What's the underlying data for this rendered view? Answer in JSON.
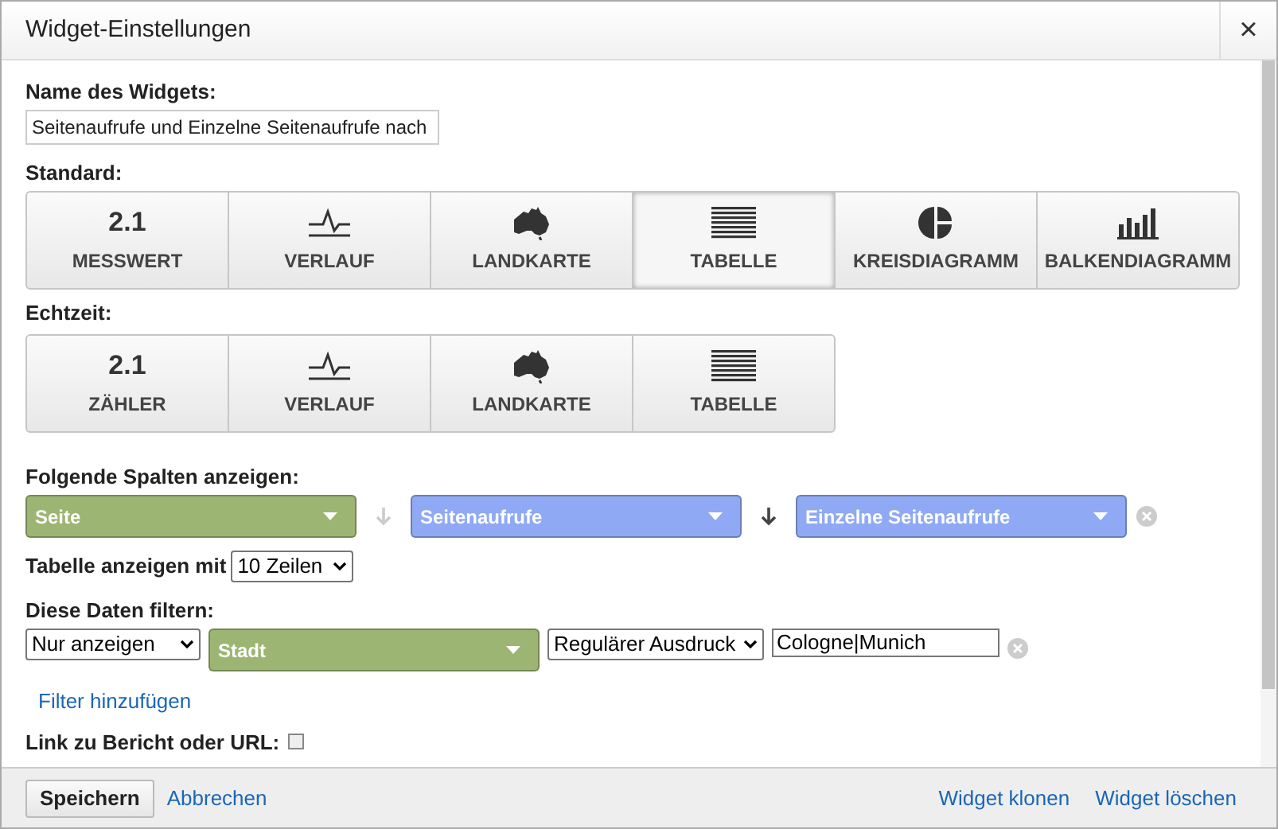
{
  "window": {
    "title": "Widget-Einstellungen",
    "close": "×"
  },
  "name_field": {
    "label": "Name des Widgets:",
    "value": "Seitenaufrufe und Einzelne Seitenaufrufe nach"
  },
  "standard": {
    "label": "Standard:",
    "tiles": [
      {
        "kind": "number",
        "icon_text": "2.1",
        "label": "MESSWERT",
        "selected": false
      },
      {
        "kind": "timeline",
        "label": "VERLAUF",
        "selected": false
      },
      {
        "kind": "map",
        "label": "LANDKARTE",
        "selected": false
      },
      {
        "kind": "table",
        "label": "TABELLE",
        "selected": true
      },
      {
        "kind": "pie",
        "label": "KREISDIAGRAMM",
        "selected": false
      },
      {
        "kind": "bar",
        "label": "BALKENDIAGRAMM",
        "selected": false
      }
    ]
  },
  "realtime": {
    "label": "Echtzeit:",
    "tiles": [
      {
        "kind": "number",
        "icon_text": "2.1",
        "label": "ZÄHLER",
        "selected": false
      },
      {
        "kind": "timeline",
        "label": "VERLAUF",
        "selected": false
      },
      {
        "kind": "map",
        "label": "LANDKARTE",
        "selected": false
      },
      {
        "kind": "table",
        "label": "TABELLE",
        "selected": false
      }
    ]
  },
  "columns": {
    "label": "Folgende Spalten anzeigen:",
    "items": [
      {
        "name": "Seite",
        "color": "#9cb572",
        "sort_disabled": true
      },
      {
        "name": "Seitenaufrufe",
        "color": "#8fa9f5",
        "sort_disabled": false
      },
      {
        "name": "Einzelne Seitenaufrufe",
        "color": "#8fa9f5"
      }
    ]
  },
  "rows": {
    "label": "Tabelle anzeigen mit",
    "value": "10 Zeilen"
  },
  "filter": {
    "label": "Diese Daten filtern:",
    "mode": "Nur anzeigen",
    "dimension": {
      "name": "Stadt",
      "color": "#9cb572"
    },
    "match": "Regulärer Ausdruck",
    "value": "Cologne|Munich",
    "add_link": "Filter hinzufügen"
  },
  "link": {
    "label": "Link zu Bericht oder URL:",
    "checked": false
  },
  "footer": {
    "save": "Speichern",
    "cancel": "Abbrechen",
    "clone": "Widget klonen",
    "delete": "Widget löschen"
  }
}
